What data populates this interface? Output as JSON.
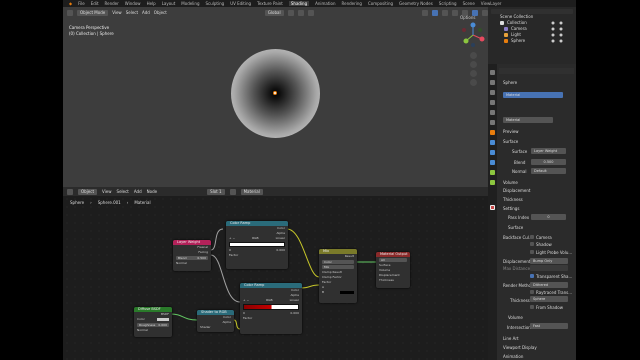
{
  "topbar": {
    "menus": [
      "File",
      "Edit",
      "Render",
      "Window",
      "Help"
    ],
    "workspaces": [
      "Layout",
      "Modeling",
      "Sculpting",
      "UV Editing",
      "Texture Paint",
      "Shading",
      "Animation",
      "Rendering",
      "Compositing",
      "Geometry Nodes",
      "Scripting"
    ],
    "active_workspace": "Shading",
    "scene": "Scene",
    "view_layer": "ViewLayer"
  },
  "viewport": {
    "mode": "Object Mode",
    "menus": [
      "View",
      "Select",
      "Add",
      "Object"
    ],
    "orientation": "Global",
    "camera_label": "Camera Perspective",
    "collection_label": "(0) Collection | Sphere",
    "options_label": "Options"
  },
  "outliner": {
    "root": "Scene Collection",
    "collection": "Collection",
    "items": [
      "Camera",
      "Light",
      "Sphere"
    ]
  },
  "node_editor": {
    "mode": "Object",
    "menus": [
      "View",
      "Select",
      "Add",
      "Node"
    ],
    "slot": "Slot 1",
    "material": "Material",
    "breadcrumb": [
      "Sphere",
      "Sphere.001",
      "Material"
    ],
    "nodes": {
      "layer_weight": {
        "title": "Layer Weight",
        "outputs": [
          "Fresnel",
          "Facing"
        ],
        "blend_label": "Blend",
        "blend_value": "0.500",
        "normal_label": "Normal"
      },
      "color_ramp_1": {
        "title": "Color Ramp",
        "outputs": [
          "Color",
          "Alpha"
        ],
        "mode": "RGB",
        "interp": "Linear",
        "pos": "0",
        "pos_value": "0.000",
        "factor": "Factor"
      },
      "color_ramp_2": {
        "title": "Color Ramp",
        "outputs": [
          "Color",
          "Alpha"
        ],
        "mode": "RGB",
        "interp": "Linear",
        "pos": "0",
        "pos_value": "0.000",
        "factor": "Factor"
      },
      "mix": {
        "title": "Mix",
        "output": "Result",
        "type": "Color",
        "blend": "Mix",
        "clamp": "Clamp Result",
        "clamp_factor": "Clamp Factor",
        "factor": "Factor",
        "a": "A",
        "b": "B"
      },
      "material_output": {
        "title": "Material Output",
        "target": "All",
        "inputs": [
          "Surface",
          "Volume",
          "Displacement",
          "Thickness"
        ]
      },
      "diffuse": {
        "title": "Diffuse BSDF",
        "output": "BSDF",
        "color": "Color",
        "roughness_label": "Roughness",
        "roughness_value": "0.000",
        "normal": "Normal"
      },
      "shader_rgb": {
        "title": "Shader to RGB",
        "outputs": [
          "Color",
          "Alpha"
        ],
        "input": "Shader"
      }
    }
  },
  "properties": {
    "object": "Sphere",
    "material_slot": "Material",
    "material_name": "Material",
    "sections": {
      "preview": "Preview",
      "surface": "Surface",
      "volume": "Volume",
      "displacement": "Displacement",
      "thickness": "Thickness",
      "settings": "Settings",
      "surface2": "Surface",
      "volume2": "Volume",
      "lineart": "Line Art",
      "viewport_display": "Viewport Display",
      "animation": "Animation"
    },
    "surface_label": "Surface",
    "surface_value": "Layer Weight",
    "blend_label": "Blend",
    "blend_value": "0.500",
    "normal_label": "Normal",
    "normal_value": "Default",
    "pass_index_label": "Pass Index",
    "pass_index_value": "0",
    "backface_label": "Backface Cul...",
    "camera_label": "Camera",
    "shadow_label": "Shadow",
    "light_probe_label": "Light Probe Volu...",
    "displacement_label": "Displacement",
    "displacement_value": "Bump Only",
    "max_distance_label": "Max Distance",
    "transparent_shadows_label": "Transparent Sha...",
    "render_method_label": "Render Method",
    "render_method_value": "Dithered",
    "raytraced_label": "Raytraced Trans...",
    "thickness_label": "Thickness",
    "thickness_value": "Sphere",
    "from_shadow_label": "From Shadow",
    "intersection_label": "Intersection",
    "intersection_value": "Fast"
  }
}
